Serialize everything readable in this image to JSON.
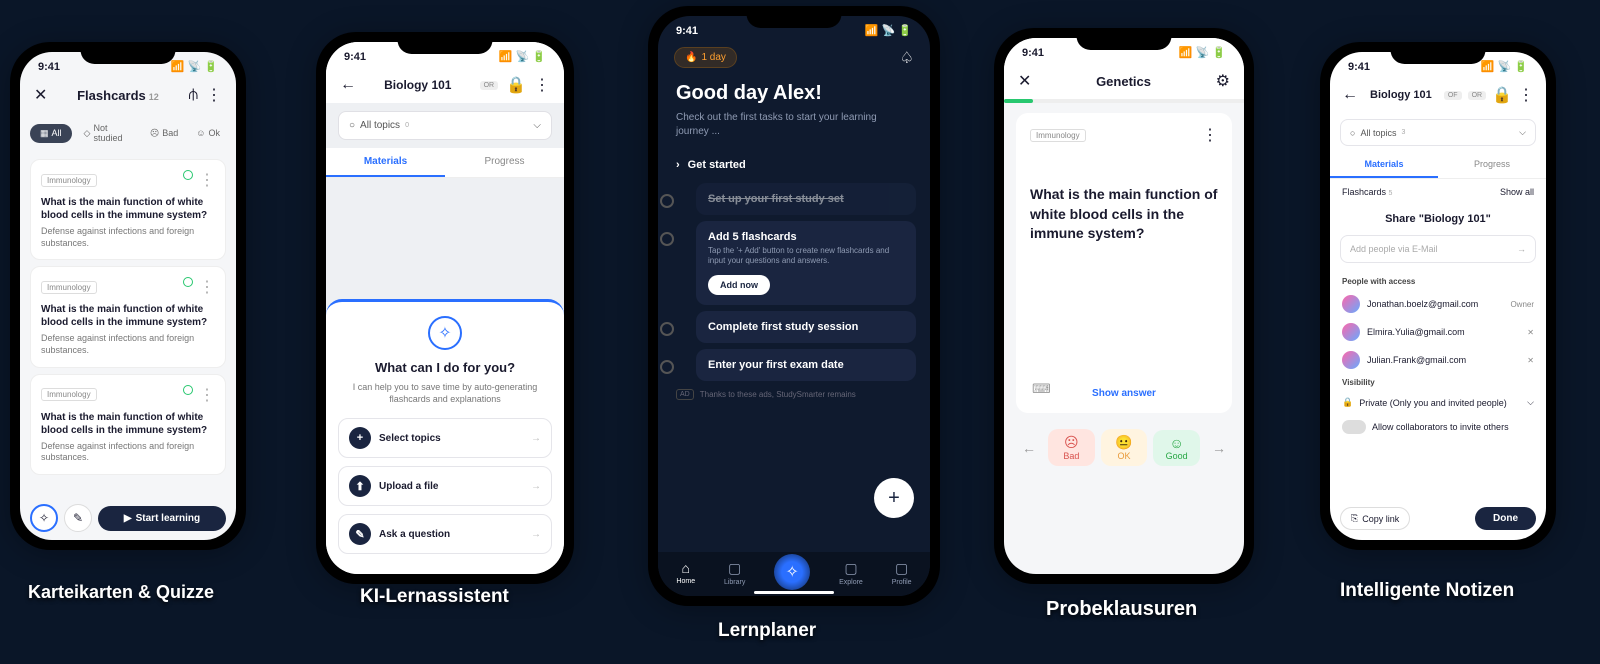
{
  "statusTime": "9:41",
  "phone1": {
    "title": "Flashcards",
    "count": "12",
    "filters": {
      "all": "All",
      "notStudied": "Not studied",
      "bad": "Bad",
      "ok": "Ok"
    },
    "cards": [
      {
        "tag": "Immunology",
        "q": "What is the main function of white blood cells in the immune system?",
        "a": "Defense against infections and foreign substances."
      },
      {
        "tag": "Immunology",
        "q": "What is the main function of white blood cells in the immune system?",
        "a": "Defense against infections and foreign substances."
      },
      {
        "tag": "Immunology",
        "q": "What is the main function of white blood cells in the immune system?",
        "a": "Defense against infections and foreign substances."
      }
    ],
    "startLearning": "Start learning"
  },
  "phone2": {
    "title": "Biology 101",
    "or": "OR",
    "allTopics": "All topics",
    "topicCount": "0",
    "tabs": {
      "materials": "Materials",
      "progress": "Progress"
    },
    "aiTitle": "What can I do for you?",
    "aiSub": "I can help you to save time by auto-generating flashcards and explanations",
    "opts": {
      "select": "Select topics",
      "upload": "Upload a file",
      "ask": "Ask a question"
    }
  },
  "phone3": {
    "streak": "1 day",
    "greeting": "Good day Alex!",
    "sub": "Check out the first tasks to start your learning journey ...",
    "getStarted": "Get started",
    "tasks": {
      "t1": "Set up your first study set",
      "t2": "Add 5 flashcards",
      "t2sub": "Tap the '+ Add' button to create new flashcards and input your questions and answers.",
      "addNow": "Add now",
      "t3": "Complete first study session",
      "t4": "Enter your first exam date"
    },
    "adLabel": "AD",
    "adText": "Thanks to these ads, StudySmarter remains",
    "nav": {
      "home": "Home",
      "library": "Library",
      "explore": "Explore",
      "profile": "Profile"
    }
  },
  "phone4": {
    "title": "Genetics",
    "tag": "Immunology",
    "q": "What is the main function of white blood cells in the immune system?",
    "showAnswer": "Show answer",
    "ratings": {
      "bad": "Bad",
      "ok": "OK",
      "good": "Good"
    }
  },
  "phone5": {
    "title": "Biology 101",
    "of": "OF",
    "or": "OR",
    "allTopics": "All topics",
    "topicCount": "3",
    "tabs": {
      "materials": "Materials",
      "progress": "Progress"
    },
    "flashcards": "Flashcards",
    "fcCount": "5",
    "showAll": "Show all",
    "shareTitle": "Share \"Biology 101\"",
    "emailPlaceholder": "Add people via E-Mail",
    "accessLabel": "People with access",
    "people": [
      {
        "email": "Jonathan.boelz@gmail.com",
        "role": "Owner"
      },
      {
        "email": "Elmira.Yulia@gmail.com",
        "role": "✕"
      },
      {
        "email": "Julian.Frank@gmail.com",
        "role": "✕"
      }
    ],
    "visibility": "Visibility",
    "private": "Private (Only you and invited people)",
    "allowCollab": "Allow collaborators to invite others",
    "copyLink": "Copy link",
    "done": "Done"
  },
  "captions": {
    "c1": "Karteikarten & Quizze",
    "c2": "KI-Lernassistent",
    "c3": "Lernplaner",
    "c4": "Probeklausuren",
    "c5": "Intelligente Notizen"
  }
}
